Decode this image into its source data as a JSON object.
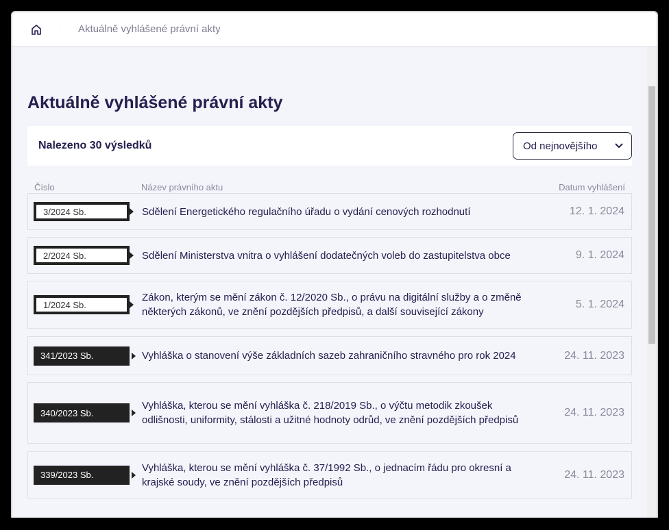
{
  "breadcrumb": {
    "current": "Aktuálně vyhlášené právní akty"
  },
  "page_title": "Aktuálně vyhlášené právní akty",
  "results_count": "Nalezeno 30 výsledků",
  "sort": {
    "selected": "Od nejnovějšího"
  },
  "columns": {
    "number": "Číslo",
    "name": "Název právního aktu",
    "date": "Datum vyhlášení"
  },
  "rows": [
    {
      "number": "3/2024 Sb.",
      "name": "Sdělení Energetického regulačního úřadu o vydání cenových rozhodnutí",
      "date": "12. 1. 2024"
    },
    {
      "number": "2/2024 Sb.",
      "name": "Sdělení Ministerstva vnitra o vyhlášení dodatečných voleb do zastupitelstva obce",
      "date": "9. 1. 2024"
    },
    {
      "number": "1/2024 Sb.",
      "name": "Zákon, kterým se mění zákon č. 12/2020 Sb., o právu na digitální služby a o změně některých zákonů, ve znění pozdějších předpisů, a další související zákony",
      "date": "5. 1. 2024"
    },
    {
      "number": "341/2023 Sb.",
      "name": "Vyhláška o stanovení výše základních sazeb zahraničního stravného pro rok 2024",
      "date": "24. 11. 2023"
    },
    {
      "number": "340/2023 Sb.",
      "name": "Vyhláška, kterou se mění vyhláška č. 218/2019 Sb., o výčtu metodik zkoušek odlišnosti, uniformity, stálosti a užitné hodnoty odrůd, ve znění pozdějších předpisů",
      "date": "24. 11. 2023"
    },
    {
      "number": "339/2023 Sb.",
      "name": "Vyhláška, kterou se mění vyhláška č. 37/1992 Sb., o jednacím řádu pro okresní a krajské soudy, ve znění pozdějších předpisů",
      "date": "24. 11. 2023"
    }
  ]
}
